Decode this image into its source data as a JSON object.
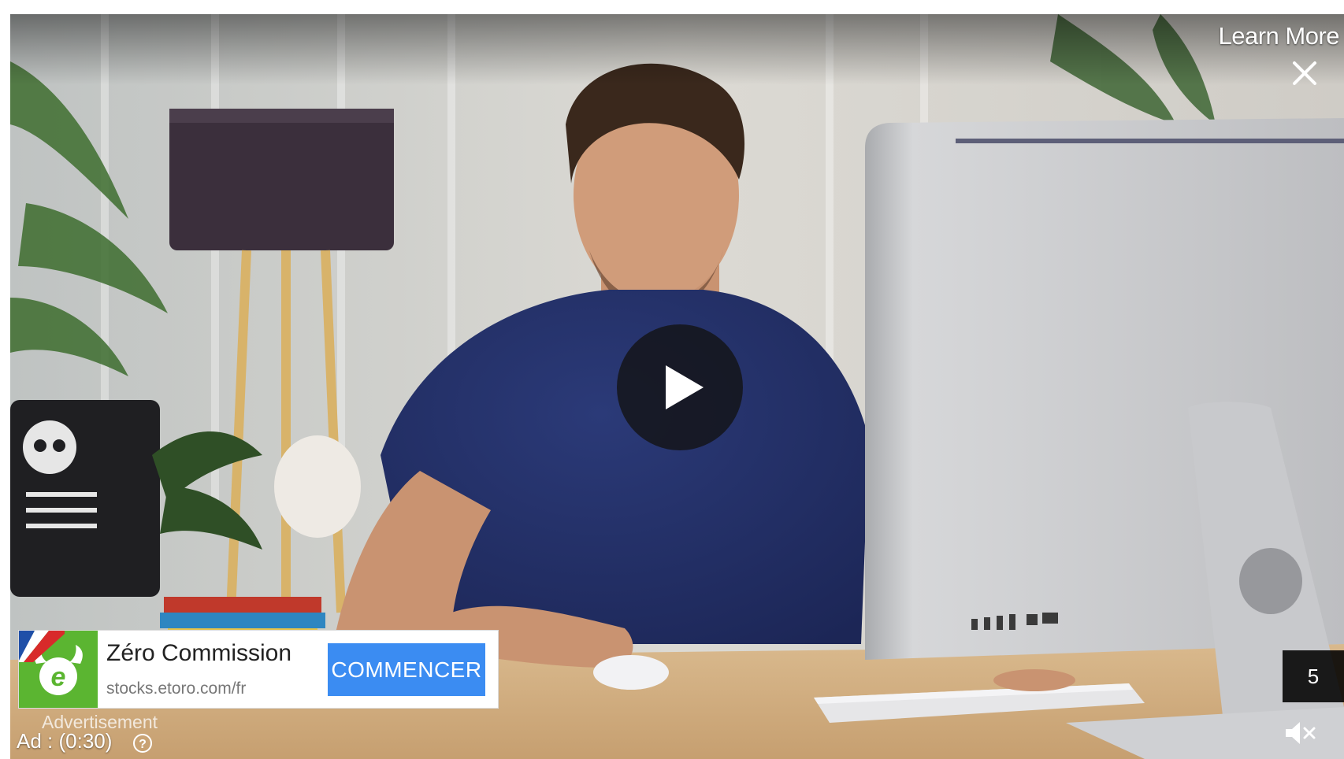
{
  "ad": {
    "learn_more": "Learn More",
    "title": "Zéro Commission",
    "url": "stocks.etoro.com/fr",
    "cta": "COMMENCER",
    "label": "Advertisement",
    "timer": "Ad : (0:30)",
    "skip_countdown": "5"
  },
  "icons": {
    "close": "close-icon",
    "play": "play-icon",
    "help": "help-icon",
    "mute": "mute-icon",
    "logo": "etoro-logo-icon",
    "flag": "french-flag-icon"
  },
  "colors": {
    "cta": "#3b8cf2",
    "logo_green": "#5bb531"
  }
}
